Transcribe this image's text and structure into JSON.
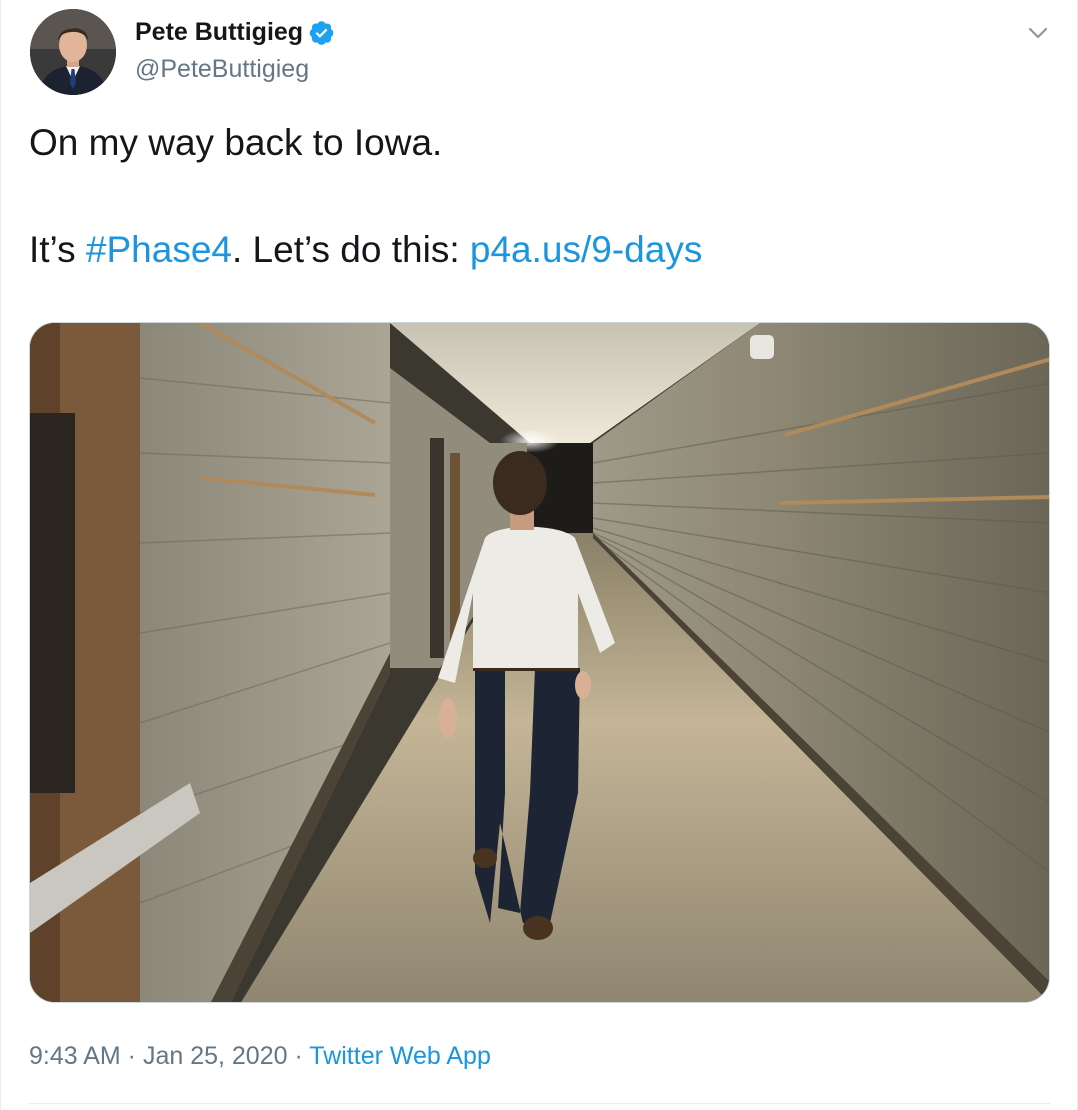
{
  "author": {
    "name": "Pete Buttigieg",
    "handle": "@PeteButtigieg",
    "verified": true
  },
  "tweet": {
    "line1": "On my way back to Iowa.",
    "line2_prefix": "It’s ",
    "hashtag": "#Phase4",
    "line2_middle": ". Let’s do this: ",
    "link": "p4a.us/9-days"
  },
  "meta": {
    "time": "9:43 AM",
    "separator1": " · ",
    "date": "Jan 25, 2020",
    "separator2": " · ",
    "app": "Twitter Web App"
  },
  "colors": {
    "link": "#1b95e0",
    "text": "#14171a",
    "secondary": "#657786",
    "verified": "#1da1f2"
  },
  "icons": {
    "verified": "verified-badge-icon",
    "caret": "chevron-down-icon"
  }
}
